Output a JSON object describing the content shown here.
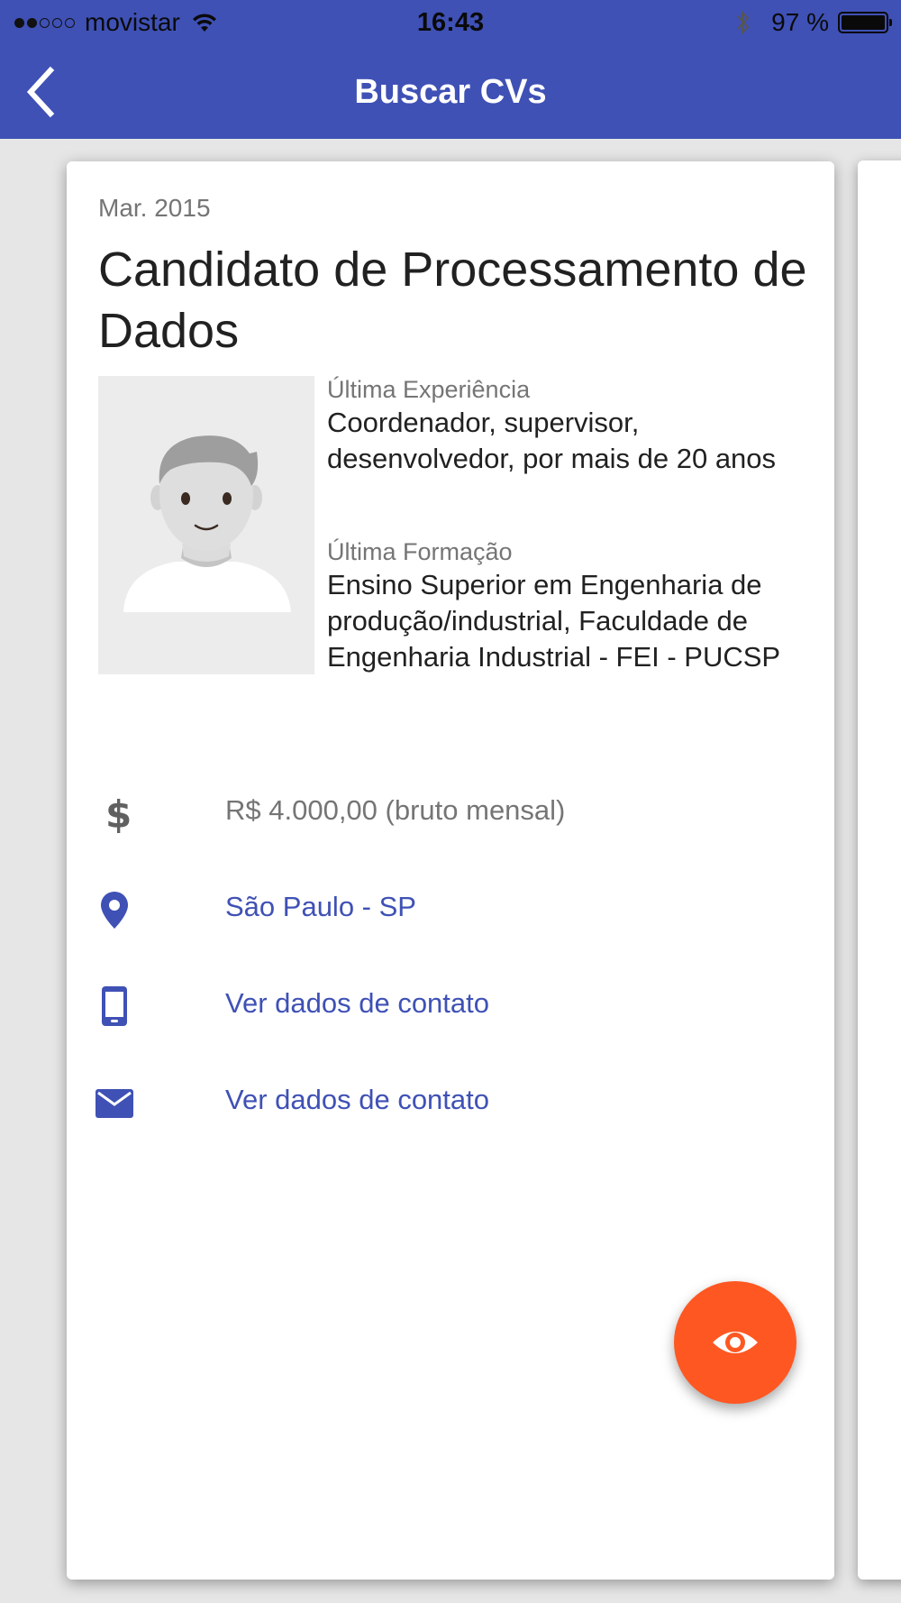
{
  "status_bar": {
    "carrier": "movistar",
    "time": "16:43",
    "battery_text": "97 %",
    "battery_level": 0.97,
    "signal_bars_filled": 2,
    "signal_bars_total": 5
  },
  "nav": {
    "title": "Buscar CVs",
    "back_icon": "chevron-left-icon"
  },
  "card": {
    "date": "Mar. 2015",
    "title": "Candidato de Processamento de Dados",
    "experience_label": "Última Experiência",
    "experience_value": "Coordenador, supervisor, desenvolvedor, por  mais de 20 anos",
    "education_label": "Última Formação",
    "education_value": "Ensino Superior em Engenharia de produção/industrial, Faculdade de Engenharia Industrial - FEI - PUCSP",
    "salary": "R$ 4.000,00 (bruto mensal)",
    "location": "São Paulo - SP",
    "phone_link": "Ver dados de contato",
    "email_link": "Ver dados de contato"
  },
  "icons": {
    "salary": "dollar-icon",
    "location": "location-pin-icon",
    "phone": "smartphone-icon",
    "email": "envelope-icon",
    "fab": "eye-icon"
  },
  "colors": {
    "primary": "#3f51b5",
    "accent": "#ff5722",
    "secondary_text": "#757575",
    "primary_text": "#212121",
    "background": "#e6e6e6"
  }
}
